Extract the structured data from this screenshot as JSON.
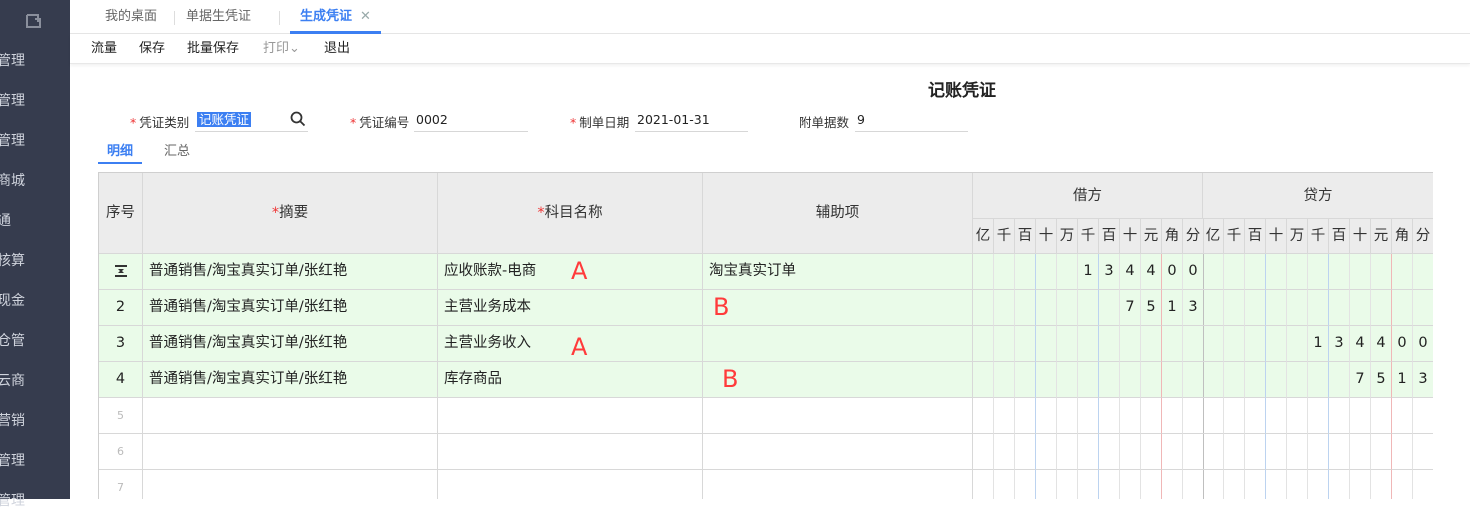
{
  "sidebar": {
    "items": [
      "管理",
      "管理",
      "管理",
      "商城",
      "通",
      "核算",
      "现金",
      "仓管",
      "云商",
      "营销",
      "管理",
      "管理"
    ]
  },
  "tabs": [
    {
      "label": "我的桌面"
    },
    {
      "label": "单据生凭证"
    },
    {
      "label": "生成凭证",
      "close": "✕"
    }
  ],
  "toolbar": {
    "flow": "流量",
    "save": "保存",
    "batch_save": "批量保存",
    "print": "打印",
    "print_caret": "⌄",
    "exit": "退出"
  },
  "voucher": {
    "title": "记账凭证",
    "type_label": "凭证类别",
    "type_value": "记账凭证",
    "number_label": "凭证编号",
    "number_value": "0002",
    "date_label": "制单日期",
    "date_value": "2021-01-31",
    "attach_label": "附单据数",
    "attach_value": "9",
    "required_mark": "*"
  },
  "subtabs": {
    "detail": "明细",
    "summary": "汇总"
  },
  "grid": {
    "headers": {
      "seq": "序号",
      "summary": "摘要",
      "account": "科目名称",
      "aux": "辅助项",
      "debit": "借方",
      "credit": "贷方"
    },
    "units": [
      "亿",
      "千",
      "百",
      "十",
      "万",
      "千",
      "百",
      "十",
      "元",
      "角",
      "分"
    ],
    "rows": [
      {
        "seq": "",
        "summary": "普通销售/淘宝真实订单/张红艳",
        "account": "应收账款-电商",
        "aux": "淘宝真实订单",
        "debit": "134400",
        "credit": ""
      },
      {
        "seq": "2",
        "summary": "普通销售/淘宝真实订单/张红艳",
        "account": "主营业务成本",
        "aux": "",
        "debit": "7513",
        "credit": ""
      },
      {
        "seq": "3",
        "summary": "普通销售/淘宝真实订单/张红艳",
        "account": "主营业务收入",
        "aux": "",
        "debit": "",
        "credit": "134400"
      },
      {
        "seq": "4",
        "summary": "普通销售/淘宝真实订单/张红艳",
        "account": "库存商品",
        "aux": "",
        "debit": "",
        "credit": "7513"
      },
      {
        "seq": "5",
        "summary": "",
        "account": "",
        "aux": "",
        "debit": "",
        "credit": ""
      },
      {
        "seq": "6",
        "summary": "",
        "account": "",
        "aux": "",
        "debit": "",
        "credit": ""
      },
      {
        "seq": "7",
        "summary": "",
        "account": "",
        "aux": "",
        "debit": "",
        "credit": ""
      }
    ]
  },
  "annotations": [
    "A",
    "B",
    "A",
    "B"
  ],
  "colors": {
    "accent": "#3c7ff2",
    "sidebar": "#363c4e",
    "row_filled": "#eafbe9",
    "annotation": "#ff3b3b",
    "required": "#ee3333"
  }
}
